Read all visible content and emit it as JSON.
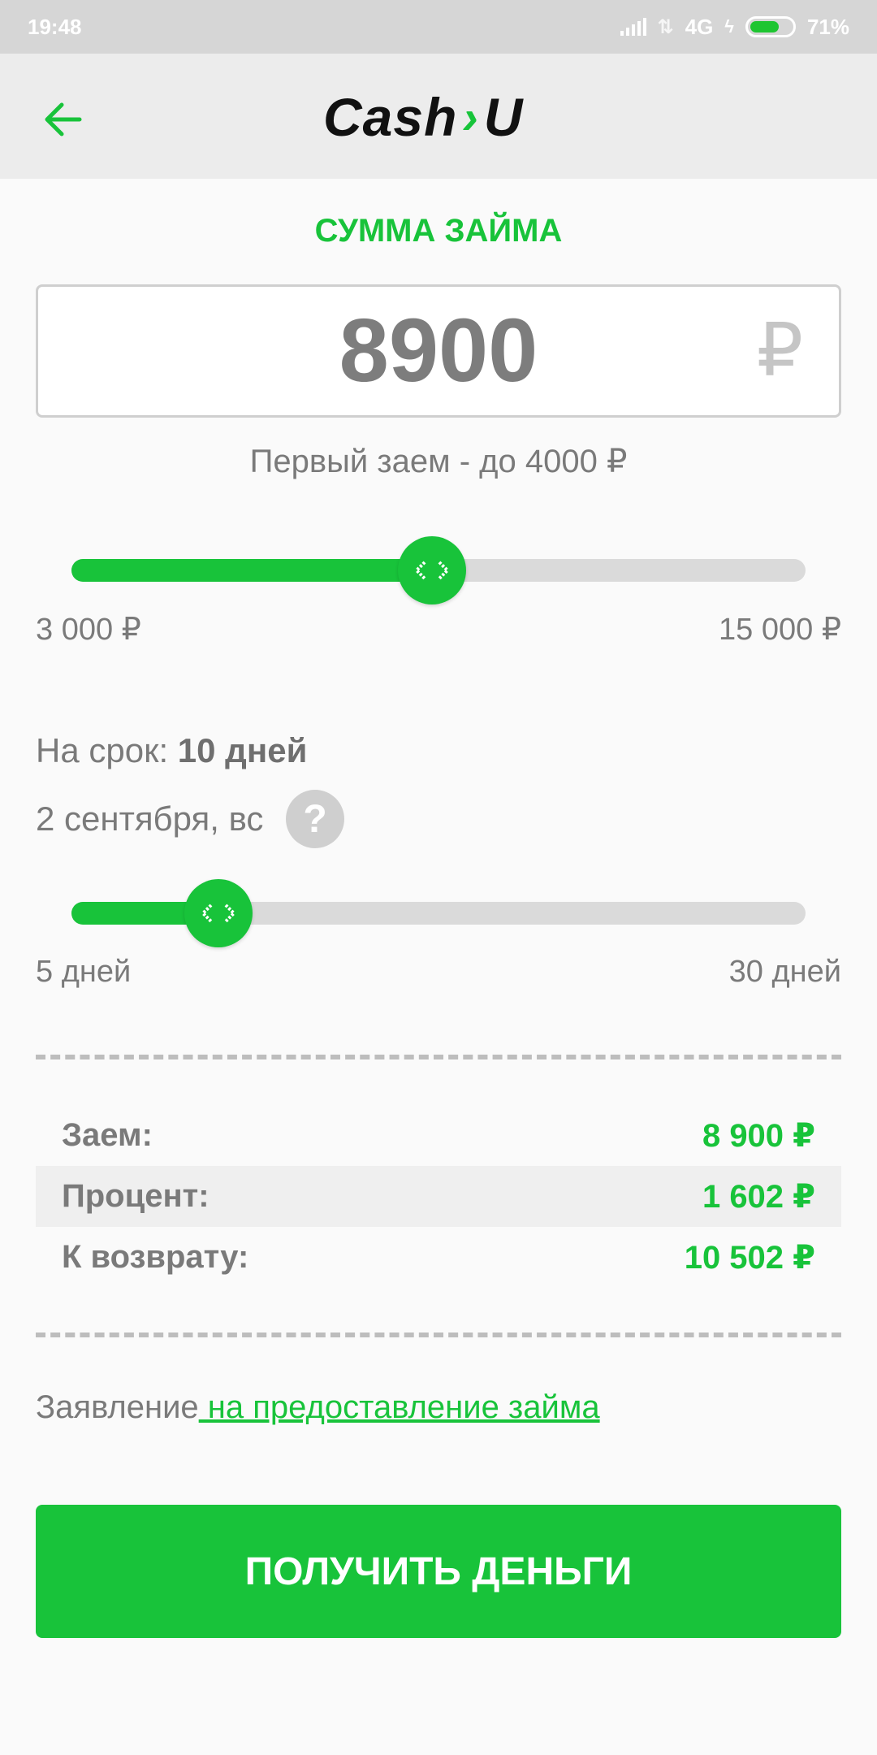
{
  "status_bar": {
    "time": "19:48",
    "network": "4G",
    "battery": "71%",
    "battery_level": 0.71
  },
  "header": {
    "back_icon": "arrow-left-icon",
    "logo_left": "Cash",
    "logo_right": "U"
  },
  "amount": {
    "title": "СУММА ЗАЙМА",
    "value": "8900",
    "currency": "₽",
    "hint": "Первый заем - до 4000 ₽",
    "slider_min_label": "3 000 ₽",
    "slider_max_label": "15 000 ₽",
    "min": 3000,
    "max": 15000,
    "current": 8900
  },
  "term": {
    "label": "На срок:",
    "value": "10 дней",
    "date": "2 сентября, вс",
    "help_icon": "?",
    "slider_min_label": "5 дней",
    "slider_max_label": "30 дней",
    "min": 5,
    "max": 30,
    "current": 10
  },
  "summary": [
    {
      "label": "Заем:",
      "value": "8 900 ₽"
    },
    {
      "label": "Процент:",
      "value": "1 602 ₽"
    },
    {
      "label": "К возврату:",
      "value": "10 502 ₽"
    }
  ],
  "statement": {
    "prefix": "Заявление",
    "link": " на предоставление займа"
  },
  "cta": {
    "label": "ПОЛУЧИТЬ ДЕНЬГИ"
  },
  "colors": {
    "accent": "#18c33a",
    "text_gray": "#7a7a7a"
  }
}
